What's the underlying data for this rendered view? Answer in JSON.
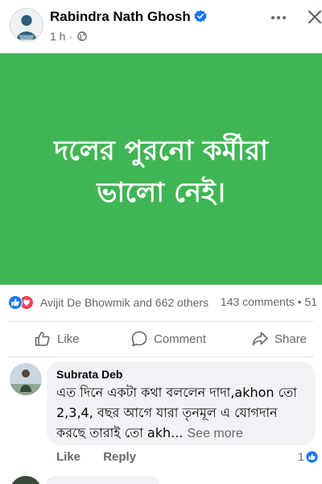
{
  "post": {
    "author": "Rabindra Nath Ghosh",
    "time": "1 h ·",
    "banner_text_line1": "দলের পুরনো কর্মীরা",
    "banner_text_line2": "ভালো নেই।",
    "banner_color": "#3fb653"
  },
  "reactions": {
    "names": "Avijit De Bhowmik and 662 others",
    "stats": "143 comments • 51"
  },
  "actions": {
    "like": "Like",
    "comment": "Comment",
    "share": "Share"
  },
  "comment": {
    "author": "Subrata Deb",
    "text": "এত দিনে একটা কথা বললেন দাদা,akhon তো 2,3,4, বছর আগে যারা তৃনমূল এ যোগদান করছে তারাই তো akh...",
    "see_more": "See more",
    "like": "Like",
    "reply": "Reply",
    "reaction_count": "1"
  },
  "colors": {
    "facebook_blue": "#1877f2",
    "love_red": "#f33e58",
    "secondary_text": "#65676b"
  },
  "icons": [
    "verified-badge-icon",
    "globe-icon",
    "more-options-icon",
    "close-icon",
    "like-reaction-icon",
    "love-reaction-icon",
    "thumbs-up-icon",
    "comment-icon",
    "share-icon"
  ]
}
